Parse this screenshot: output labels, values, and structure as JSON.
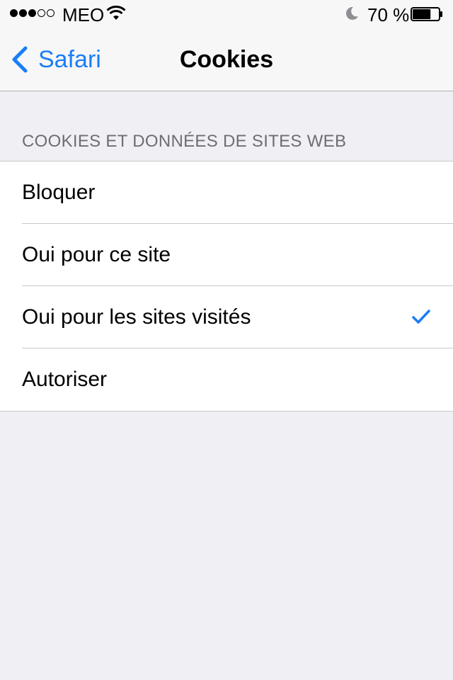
{
  "status_bar": {
    "carrier": "MEO",
    "battery_percent": "70 %",
    "signal_bars_filled": 3,
    "signal_bars_total": 5,
    "battery_level": 0.7,
    "icons": [
      "signal-icon",
      "wifi-icon",
      "moon-icon",
      "battery-icon"
    ]
  },
  "nav": {
    "back_label": "Safari",
    "title": "Cookies"
  },
  "section": {
    "header": "COOKIES ET DONNÉES DE SITES WEB"
  },
  "options": [
    {
      "label": "Bloquer",
      "selected": false
    },
    {
      "label": "Oui pour ce site",
      "selected": false
    },
    {
      "label": "Oui pour les sites visités",
      "selected": true
    },
    {
      "label": "Autoriser",
      "selected": false
    }
  ],
  "colors": {
    "accent": "#1a7ef7",
    "background": "#efeff4",
    "section_header_text": "#6d6d72"
  }
}
